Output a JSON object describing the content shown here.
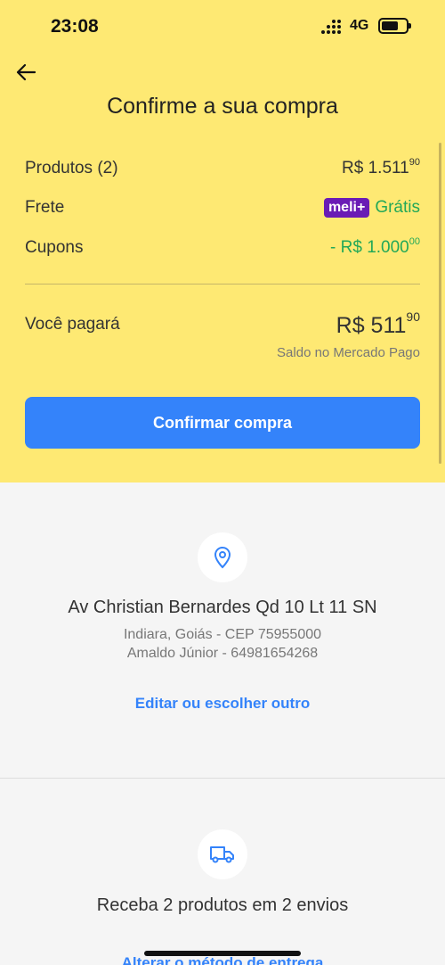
{
  "status_bar": {
    "time": "23:08",
    "network": "4G"
  },
  "header": {
    "title": "Confirme a sua compra"
  },
  "summary": {
    "products": {
      "label": "Produtos (2)",
      "value": "R$ 1.511",
      "cents": "90"
    },
    "shipping": {
      "label": "Frete",
      "badge": "meli+",
      "value": "Grátis"
    },
    "coupons": {
      "label": "Cupons",
      "value": "- R$ 1.000",
      "cents": "00"
    },
    "total": {
      "label": "Você pagará",
      "value": "R$ 511",
      "cents": "90",
      "note": "Saldo no Mercado Pago"
    }
  },
  "confirm_button": {
    "label": "Confirmar compra"
  },
  "address": {
    "street": "Av Christian Bernardes Qd 10 Lt 11 SN",
    "city": "Indiara, Goiás - CEP 75955000",
    "recipient": "Amaldo Júnior - 64981654268",
    "edit_link": "Editar ou escolher outro"
  },
  "delivery": {
    "text": "Receba 2 produtos em 2 envios",
    "change_link": "Alterar o método de entrega"
  },
  "colors": {
    "yellow": "#fee973",
    "blue": "#3483fa",
    "green": "#23a858",
    "meli_purple": "#6a1bb5"
  }
}
